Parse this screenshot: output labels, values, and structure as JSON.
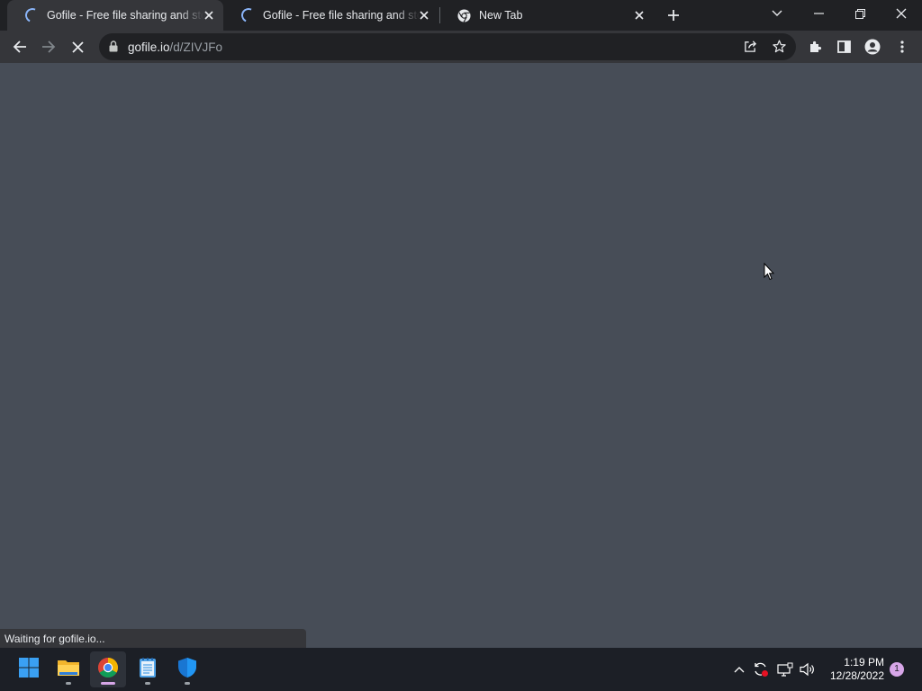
{
  "browser": {
    "tabs": [
      {
        "title": "Gofile - Free file sharing and storage",
        "state": "loading",
        "active": true
      },
      {
        "title": "Gofile - Free file sharing and storage",
        "state": "loading",
        "active": false
      },
      {
        "title": "New Tab",
        "state": "loaded",
        "favicon": "chrome-icon",
        "active": false
      }
    ],
    "address_bar": {
      "host": "gofile.io",
      "path": "/d/ZIVJFo"
    },
    "status_text": "Waiting for gofile.io...",
    "colors": {
      "content_bg": "#474d57",
      "toolbar_bg": "#35363a",
      "frame_bg": "#202124"
    }
  },
  "taskbar": {
    "apps": [
      {
        "name": "start-button",
        "icon": "windows-logo-icon"
      },
      {
        "name": "file-explorer",
        "icon": "folder-icon"
      },
      {
        "name": "google-chrome",
        "icon": "chrome-icon",
        "active": true
      },
      {
        "name": "notepad",
        "icon": "notepad-icon"
      },
      {
        "name": "windows-security",
        "icon": "shield-icon"
      }
    ],
    "clock": {
      "time": "1:19 PM",
      "date": "12/28/2022"
    },
    "notification_count": "1"
  }
}
